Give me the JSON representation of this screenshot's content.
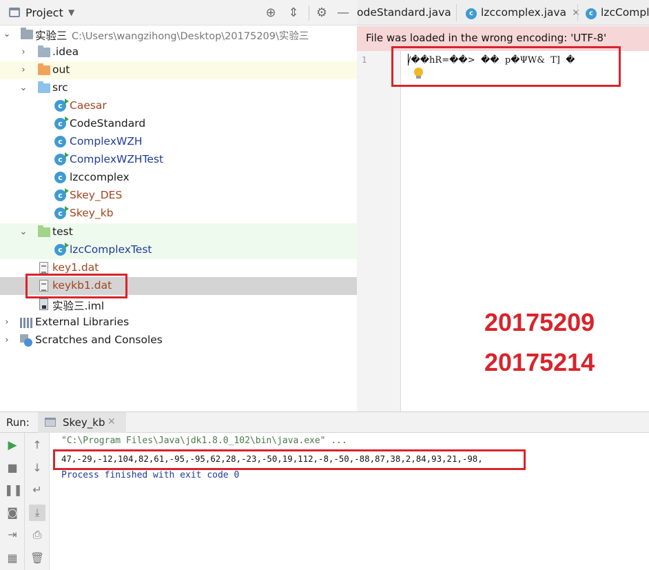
{
  "project_panel": {
    "title": "Project",
    "items": [
      {
        "label": "实验三",
        "path": "C:\\Users\\wangzihong\\Desktop\\20175209\\实验三"
      },
      {
        "label": ".idea"
      },
      {
        "label": "out"
      },
      {
        "label": "src"
      },
      {
        "label": "Caesar"
      },
      {
        "label": "CodeStandard"
      },
      {
        "label": "ComplexWZH"
      },
      {
        "label": "ComplexWZHTest"
      },
      {
        "label": "lzccomplex"
      },
      {
        "label": "Skey_DES"
      },
      {
        "label": "Skey_kb"
      },
      {
        "label": "test"
      },
      {
        "label": "lzcComplexTest"
      },
      {
        "label": "key1.dat"
      },
      {
        "label": "keykb1.dat"
      },
      {
        "label": "实验三.iml"
      },
      {
        "label": "External Libraries"
      },
      {
        "label": "Scratches and Consoles"
      }
    ]
  },
  "editor": {
    "tabs": [
      "odeStandard.java",
      "lzccomplex.java",
      "lzcComple"
    ],
    "encoding_warning": "File was loaded in the wrong encoding: 'UTF-8'",
    "line_number": "1",
    "code_line": "/��hR=��>  ��  p�ΨW&  T]  �",
    "stamp_lines": [
      "20175209",
      "20175214"
    ]
  },
  "run_panel": {
    "label": "Run:",
    "tab": "Skey_kb",
    "console": [
      "\"C:\\Program Files\\Java\\jdk1.8.0_102\\bin\\java.exe\" ...",
      "47,-29,-12,104,82,61,-95,-95,62,28,-23,-50,19,112,-8,-50,-88,87,38,2,84,93,21,-98,",
      "Process finished with exit code 0"
    ]
  },
  "colors": {
    "highlight_red": "#d9232b",
    "class_icon_blue": "#3f9bd1",
    "warning_bg": "#f6d6d6"
  }
}
